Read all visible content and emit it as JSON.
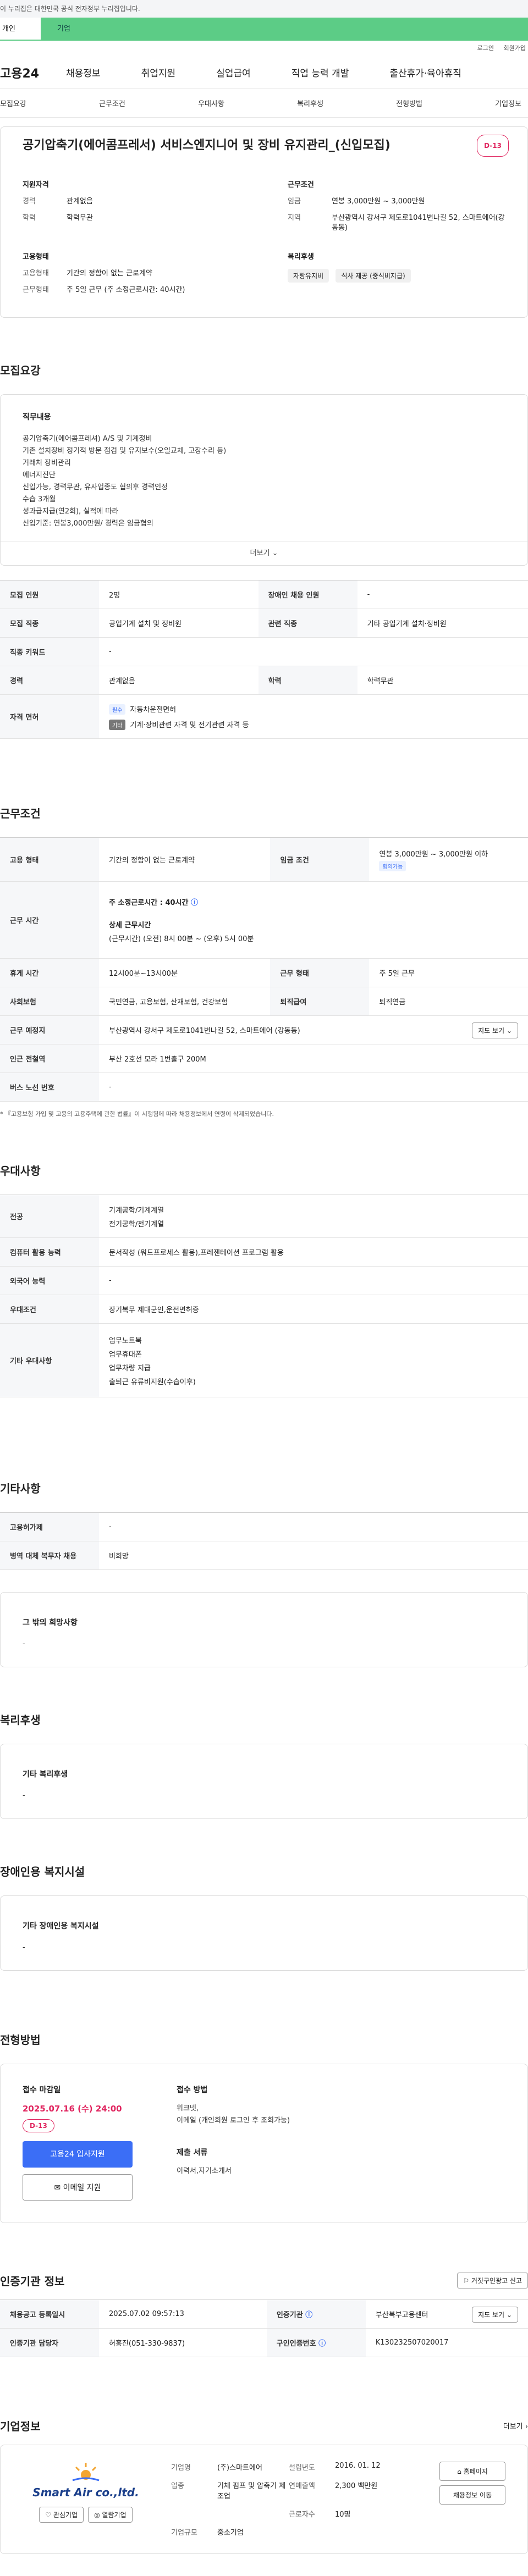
{
  "gov_banner": "이 누리집은 대한민국 공식 전자정부 누리집입니다.",
  "top_tabs": [
    "개인",
    "기업"
  ],
  "util": [
    "로그인",
    "회원가입"
  ],
  "logo": "고용24",
  "gnb": [
    "채용정보",
    "취업지원",
    "실업급여",
    "직업 능력 개발",
    "출산휴가·육아휴직"
  ],
  "snb": [
    "모집요강",
    "근무조건",
    "우대사항",
    "복리후생",
    "전형방법",
    "기업정보"
  ],
  "job_title": "공기압축기(에어콤프레서) 서비스엔지니어 및 장비 유지관리_(신입모집)",
  "dday": "D-13",
  "summary": {
    "qual_title": "지원자격",
    "qual": [
      {
        "k": "경력",
        "v": "관계없음"
      },
      {
        "k": "학력",
        "v": "학력무관"
      }
    ],
    "cond_title": "근무조건",
    "cond": [
      {
        "k": "임금",
        "v": "연봉 3,000만원 ~ 3,000만원"
      },
      {
        "k": "지역",
        "v": "부산광역시 강서구 제도로1041번나길 52, 스마트에어(강동동)"
      }
    ],
    "form_title": "고용형태",
    "form": [
      {
        "k": "고용형태",
        "v": "기간의 정함이 없는 근로계약"
      },
      {
        "k": "근무형태",
        "v": "주 5일 근무 (주 소정근로시간: 40시간)"
      }
    ],
    "welfare_title": "복리후생",
    "welfare_chips": [
      "자랑유지비",
      "식사 제공 (중식비지급)"
    ]
  },
  "recruit": {
    "title": "모집요강",
    "duty_title": "직무내용",
    "duty_lines": [
      "공기압축기(에어콤프레셔) A/S 및 기계정비",
      "기존 설치장비 정기적 방문 점검 및 유지보수(오일교체, 고장수리 등)",
      "거래처 장비관리",
      "에너지진단",
      "신입가능, 경력무관, 유사업종도 협의후 경력인정",
      "수습 3개월",
      "성과급지급(연2회), 실적에 따라",
      "신입기준: 연봉3,000만원/ 경력은 임금협의"
    ],
    "more": "더보기",
    "rows": [
      {
        "k1": "모집 인원",
        "v1": "2명",
        "k2": "장애인 채용 인원",
        "v2": "-"
      },
      {
        "k1": "모집 직종",
        "v1": "공업기계 설치 및 정비원",
        "k2": "관련 직종",
        "v2": "기타 공업기계 설치·정비원"
      },
      {
        "k1": "직종 키워드",
        "v1": "-",
        "k2": "",
        "v2": ""
      },
      {
        "k1": "경력",
        "v1": "관계없음",
        "k2": "학력",
        "v2": "학력무관"
      }
    ],
    "license_label": "자격 면허",
    "license": [
      {
        "tag": "필수",
        "v": "자동차운전면허"
      },
      {
        "tag": "기타",
        "v": "기계·장비관련 자격 및 전기관련 자격 등"
      }
    ]
  },
  "work": {
    "title": "근무조건",
    "employ_type_k": "고용 형태",
    "employ_type_v": "기간의 정함이 없는 근로계약",
    "wage_k": "임금 조건",
    "wage_v": "연봉 3,000만원 ~ 3,000만원 이하",
    "wage_tag": "협의가능",
    "hours_k": "근무 시간",
    "hours_main": "주 소정근로시간 : 40시간",
    "hours_detail_title": "상세 근무시간",
    "hours_detail": "(근무시간) (오전) 8시 00분 ~ (오후) 5시 00분",
    "break_k": "휴게 시간",
    "break_v": "12시00분~13시00분",
    "form_k": "근무 형태",
    "form_v": "주 5일 근무",
    "insure_k": "사회보험",
    "insure_v": "국민연금, 고용보험, 산재보험, 건강보험",
    "retire_k": "퇴직급여",
    "retire_v": "퇴직연금",
    "place_k": "근무 예정지",
    "place_v": "부산광역시 강서구 제도로1041번나길 52, 스마트에어 (강동동)",
    "map_btn": "지도 보기",
    "subway_k": "인근 전철역",
    "subway_v": "부산 2호선 모라 1번출구 200M",
    "bus_k": "버스 노선 번호",
    "bus_v": "-",
    "note": "* 『고용보험 가입 및 고용의 고용주택에 관한 법률』이 시행됨에 따라 채용정보에서 연령이 삭제되었습니다."
  },
  "pref": {
    "title": "우대사항",
    "major_k": "전공",
    "major_v": [
      "기계공학/기계계열",
      "전기공학/전기계열"
    ],
    "pc_k": "컴퓨터 활용 능력",
    "pc_v": "문서작성 (워드프로세스 활용),프레젠테이션 프로그램 활용",
    "lang_k": "외국어 능력",
    "lang_v": "-",
    "cond_k": "우대조건",
    "cond_v": "장기복무 제대군인,운전면허증",
    "etc_k": "기타 우대사항",
    "etc_v": [
      "업무노트북",
      "업무휴대폰",
      "업무차량 지급",
      "출퇴근 유류비지원(수습이후)"
    ]
  },
  "misc": {
    "title": "기타사항",
    "disab_k": "고용허가제",
    "disab_v": "-",
    "army_k": "병역 대체 복무자 채용",
    "army_v": "비희망",
    "wish_title": "그 밖의 희망사항",
    "wish_v": "-"
  },
  "welfare": {
    "title": "복리후생",
    "etc_title": "기타 복리후생",
    "etc_v": "-"
  },
  "disab_fac": {
    "title": "장애인용 복지시설",
    "etc_title": "기타 장애인용 복지시설",
    "etc_v": "-"
  },
  "apply": {
    "title": "전형방법",
    "deadline_title": "접수 마감일",
    "deadline": "2025.07.16 (수) 24:00",
    "dday": "D-13",
    "btn_apply": "고용24 입사지원",
    "btn_email": "이메일 지원",
    "method_title": "접수 방법",
    "method": [
      "워크넷,",
      "이메일 (개인회원 로그인 후 조회가능)"
    ],
    "docs_title": "제출 서류",
    "docs": "이력서,자기소개서"
  },
  "agency": {
    "title": "인증기관 정보",
    "report_btn": "거짓구인광고 신고",
    "reg_k": "채용공고 등록일시",
    "reg_v": "2025.07.02 09:57:13",
    "inst_k": "인증기관",
    "inst_v": "부산북부고용센터",
    "map_btn": "지도 보기",
    "mgr_k": "인증기관 담당자",
    "mgr_v": "허홍진(051-330-9837)",
    "num_k": "구인인증번호",
    "num_v": "K130232507020017"
  },
  "company": {
    "title": "기업정보",
    "more": "더보기",
    "logo_name": "Smart Air co.,ltd.",
    "follow_btn": "관심기업",
    "review_btn": "열람기업",
    "info": [
      {
        "k": "기업명",
        "v": "(주)스마트에어"
      },
      {
        "k": "설립년도",
        "v": "2016. 01. 12"
      },
      {
        "k": "업종",
        "v": "기체 펌프 및 압축기 제조업"
      },
      {
        "k": "연매출액",
        "v": "2,300 백만원"
      },
      {
        "k": "",
        "v": ""
      },
      {
        "k": "근로자수",
        "v": "10명"
      },
      {
        "k": "기업규모",
        "v": "중소기업"
      }
    ],
    "btn_home": "홈페이지",
    "btn_jobs": "채용정보 이동"
  }
}
